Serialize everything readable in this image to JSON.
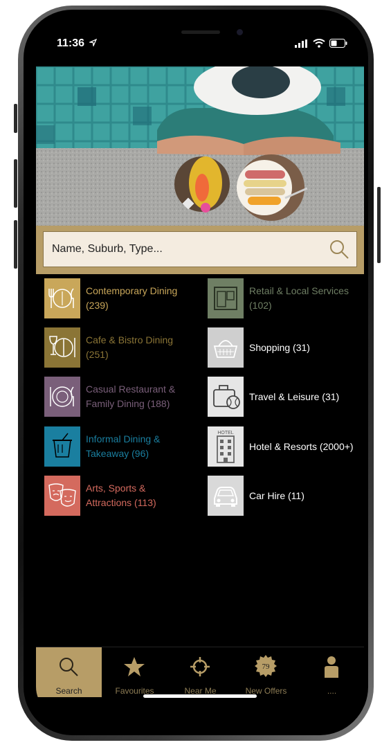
{
  "status_bar": {
    "time": "11:36",
    "location_icon": "location-arrow-icon"
  },
  "search": {
    "placeholder": "Name, Suburb, Type..."
  },
  "categories_left": [
    {
      "label": "Contemporary Dining\n(239)",
      "color": "#c9a75a",
      "icon": "dining-icon"
    },
    {
      "label": "Cafe & Bistro Dining\n(251)",
      "color": "#8b7536",
      "icon": "wine-cutlery-icon"
    },
    {
      "label": "Casual Restaurant &\nFamily Dining (188)",
      "color": "#7a5f7a",
      "icon": "plate-cutlery-icon"
    },
    {
      "label": "Informal Dining &\nTakeaway (96)",
      "color": "#1a7fa0",
      "icon": "takeaway-cup-icon"
    },
    {
      "label": "Arts, Sports &\nAttractions (113)",
      "color": "#d46a5e",
      "icon": "theatre-masks-icon"
    }
  ],
  "categories_right": [
    {
      "label": "Retail & Local Services\n(102)",
      "color": "#6f7f64",
      "icon": "shopfront-icon"
    },
    {
      "label": "Shopping (31)",
      "color": "#cfcfcf",
      "icon": "shopping-basket-icon"
    },
    {
      "label": "Travel & Leisure (31)",
      "color": "#e6e6e6",
      "icon": "suitcase-ball-icon"
    },
    {
      "label": "Hotel & Resorts (2000+)",
      "color": "#e6e6e6",
      "icon": "hotel-icon",
      "icon_text": "HOTEL"
    },
    {
      "label": "Car Hire (11)",
      "color": "#d9d9d9",
      "icon": "car-icon"
    }
  ],
  "tabs": [
    {
      "label": "Search",
      "icon": "search-icon",
      "active": true
    },
    {
      "label": "Favourites",
      "icon": "star-icon"
    },
    {
      "label": "Near Me",
      "icon": "crosshair-icon"
    },
    {
      "label": "New Offers",
      "icon": "badge-icon",
      "badge": "79"
    },
    {
      "label": "....",
      "icon": "person-icon"
    }
  ]
}
